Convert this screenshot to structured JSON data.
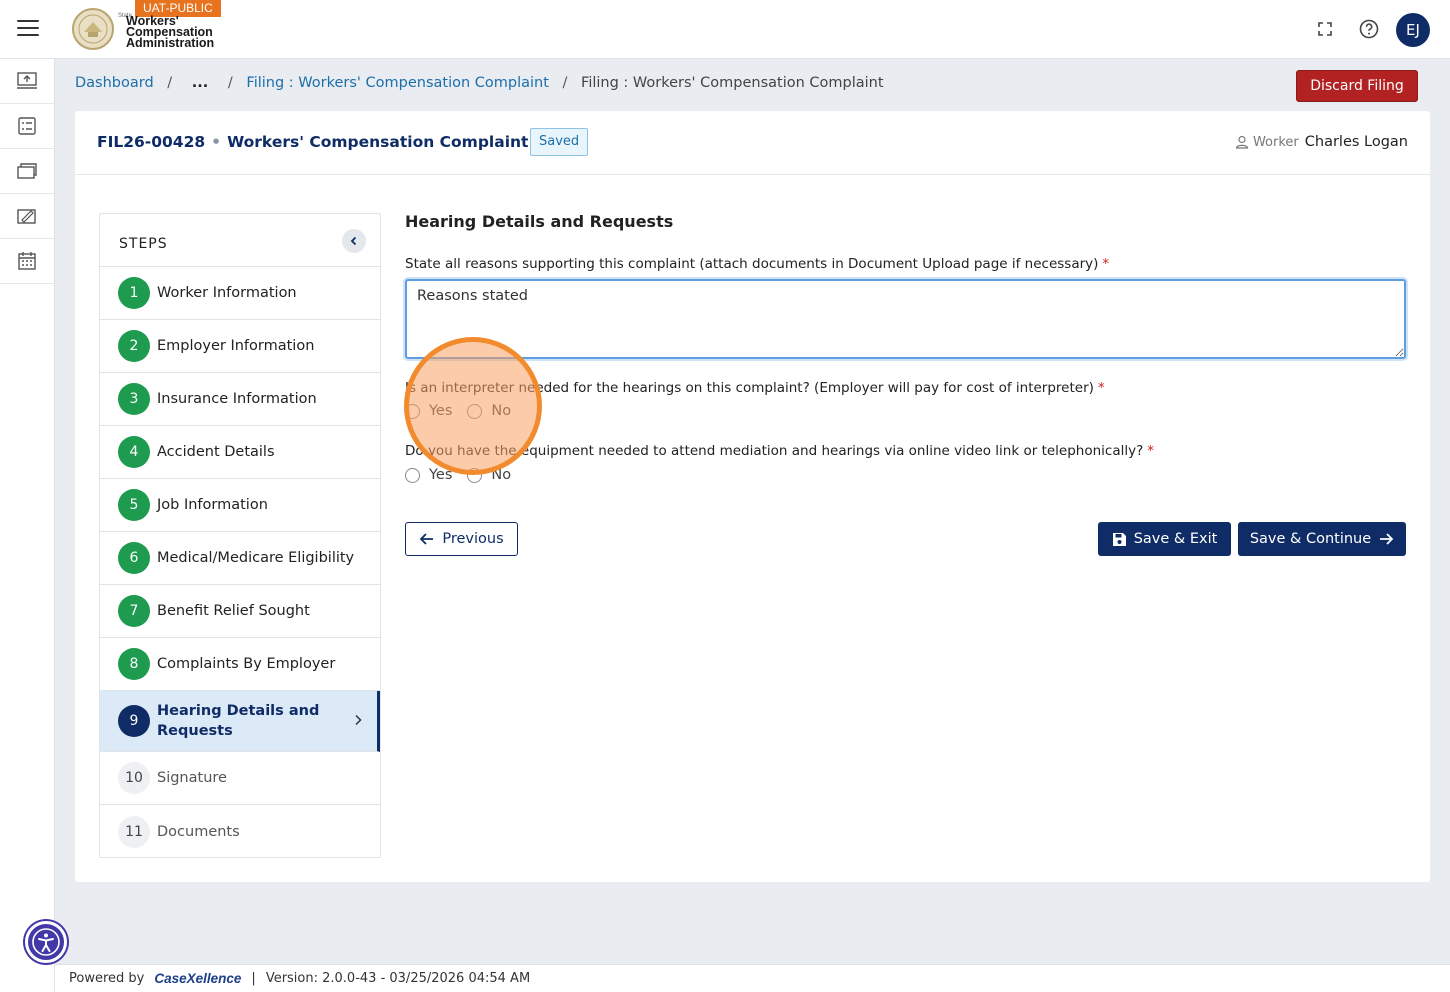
{
  "header": {
    "env_badge": "UAT-PUBLIC",
    "brand_small": "State",
    "brand_line1": "Workers'",
    "brand_line2": "Compensation",
    "brand_line3": "Administration",
    "avatar_initials": "EJ",
    "icons": [
      "menu-icon",
      "fullscreen-icon",
      "help-icon"
    ]
  },
  "rail": {
    "items": [
      "upload-icon",
      "checklist-icon",
      "briefcase-icon",
      "document-edit-icon",
      "calendar-icon"
    ]
  },
  "breadcrumb": {
    "items": [
      "Dashboard",
      "...",
      "Filing : Workers' Compensation Complaint",
      "Filing : Workers' Compensation Complaint"
    ],
    "separator": "/"
  },
  "discard_label": "Discard Filing",
  "filing": {
    "id": "FIL26-00428",
    "name": "Workers' Compensation Complaint",
    "status": "Saved",
    "worker_label": "Worker",
    "worker_name": "Charles Logan"
  },
  "steps": {
    "title": "STEPS",
    "items": [
      {
        "num": "1",
        "label": "Worker Information"
      },
      {
        "num": "2",
        "label": "Employer Information"
      },
      {
        "num": "3",
        "label": "Insurance Information"
      },
      {
        "num": "4",
        "label": "Accident Details"
      },
      {
        "num": "5",
        "label": "Job Information"
      },
      {
        "num": "6",
        "label": "Medical/Medicare Eligibility"
      },
      {
        "num": "7",
        "label": "Benefit Relief Sought"
      },
      {
        "num": "8",
        "label": "Complaints By Employer"
      },
      {
        "num": "9",
        "label": "Hearing Details and Requests"
      },
      {
        "num": "10",
        "label": "Signature"
      },
      {
        "num": "11",
        "label": "Documents"
      }
    ]
  },
  "form": {
    "section_title": "Hearing Details and Requests",
    "q1_label": "State all reasons supporting this complaint (attach documents in Document Upload page if necessary)",
    "q1_value": "Reasons stated",
    "q2_label": "Is an interpreter needed for the hearings on this complaint? (Employer will pay for cost of interpreter)",
    "q3_label": "Do you have the equipment needed to attend mediation and hearings via online video link or telephonically?",
    "yes": "Yes",
    "no": "No",
    "required_mark": "*"
  },
  "buttons": {
    "previous": "Previous",
    "save_exit": "Save & Exit",
    "save_continue": "Save & Continue"
  },
  "footer": {
    "powered_by": "Powered by",
    "brand": "CaseXellence",
    "divider": "|",
    "version": "Version: 2.0.0-43 - 03/25/2026 04:54 AM"
  },
  "colors": {
    "primary": "#0f2c66",
    "success": "#1e9b4f",
    "danger": "#b22222",
    "accent": "#e8731e"
  }
}
